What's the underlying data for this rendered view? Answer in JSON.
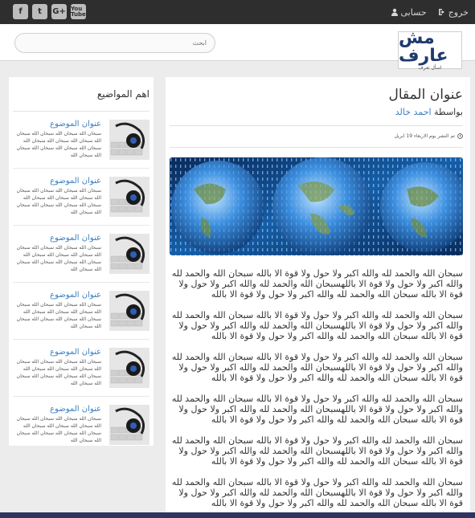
{
  "topbar": {
    "logout_label": "خروج",
    "account_label": "حسابى",
    "social": [
      "f",
      "t",
      "G+",
      "You Tube"
    ]
  },
  "header": {
    "search_placeholder": "ابحث",
    "logo_text": "مش عارف",
    "logo_sub": "اسأل تعرف"
  },
  "article": {
    "title": "عنوان المقال",
    "by_label": "بواسطة",
    "author": "احمد خالد",
    "date": "تم النشر يوم الاربعاء 19 ابريل",
    "paragraphs": [
      "سبحان الله والحمد لله والله اكبر ولا حول ولا قوة الا بالله سبحان الله والحمد لله والله اكبر ولا حول ولا قوة الا باللهسبحان الله والحمد لله والله اكبر ولا حول ولا قوة الا بالله سبحان الله والحمد لله والله اكبر ولا حول ولا قوة الا بالله",
      "سبحان الله والحمد لله والله اكبر ولا حول ولا قوة الا بالله سبحان الله والحمد لله والله اكبر ولا حول ولا قوة الا باللهسبحان الله والحمد لله والله اكبر ولا حول ولا قوة الا بالله سبحان الله والحمد لله والله اكبر ولا حول ولا قوة الا بالله",
      "سبحان الله والحمد لله والله اكبر ولا حول ولا قوة الا بالله سبحان الله والحمد لله والله اكبر ولا حول ولا قوة الا باللهسبحان الله والحمد لله والله اكبر ولا حول ولا قوة الا بالله سبحان الله والحمد لله والله اكبر ولا حول ولا قوة الا بالله",
      "سبحان الله والحمد لله والله اكبر ولا حول ولا قوة الا بالله سبحان الله والحمد لله والله اكبر ولا حول ولا قوة الا باللهسبحان الله والحمد لله والله اكبر ولا حول ولا قوة الا بالله سبحان الله والحمد لله والله اكبر ولا حول ولا قوة الا بالله",
      "سبحان الله والحمد لله والله اكبر ولا حول ولا قوة الا بالله سبحان الله والحمد لله والله اكبر ولا حول ولا قوة الا باللهسبحان الله والحمد لله والله اكبر ولا حول ولا قوة الا بالله سبحان الله والحمد لله والله اكبر ولا حول ولا قوة الا بالله",
      "سبحان الله والحمد لله والله اكبر ولا حول ولا قوة الا بالله سبحان الله والحمد لله والله اكبر ولا حول ولا قوة الا باللهسبحان الله والحمد لله والله اكبر ولا حول ولا قوة الا بالله سبحان الله والحمد لله والله اكبر ولا حول ولا قوة الا بالله"
    ]
  },
  "sidebar": {
    "title": "اهم المواضيع",
    "items": [
      {
        "title": "عنوان الموضوع",
        "body": "سبحان الله سبحان الله سبحان الله سبحان الله سبحان الله سبحان الله سبحان الله سبحان الله سبحان الله سبحان الله سبحان الله سبحان الله"
      },
      {
        "title": "عنوان الموضوع",
        "body": "سبحان الله سبحان الله سبحان الله سبحان الله سبحان الله سبحان الله سبحان الله سبحان الله سبحان الله سبحان الله سبحان الله سبحان الله"
      },
      {
        "title": "عنوان الموضوع",
        "body": "سبحان الله سبحان الله سبحان الله سبحان الله سبحان الله سبحان الله سبحان الله سبحان الله سبحان الله سبحان الله سبحان الله سبحان الله"
      },
      {
        "title": "عنوان الموضوع",
        "body": "سبحان الله سبحان الله سبحان الله سبحان الله سبحان الله سبحان الله سبحان الله سبحان الله سبحان الله سبحان الله سبحان الله سبحان الله"
      },
      {
        "title": "عنوان الموضوع",
        "body": "سبحان الله سبحان الله سبحان الله سبحان الله سبحان الله سبحان الله سبحان الله سبحان الله سبحان الله سبحان الله سبحان الله سبحان الله"
      },
      {
        "title": "عنوان الموضوع",
        "body": "سبحان الله سبحان الله سبحان الله سبحان الله سبحان الله سبحان الله سبحان الله سبحان الله سبحان الله سبحان الله سبحان الله سبحان الله"
      }
    ]
  },
  "colors": {
    "accent": "#3a7fc1",
    "topbar": "#2e2e2e",
    "background": "#ececec"
  }
}
